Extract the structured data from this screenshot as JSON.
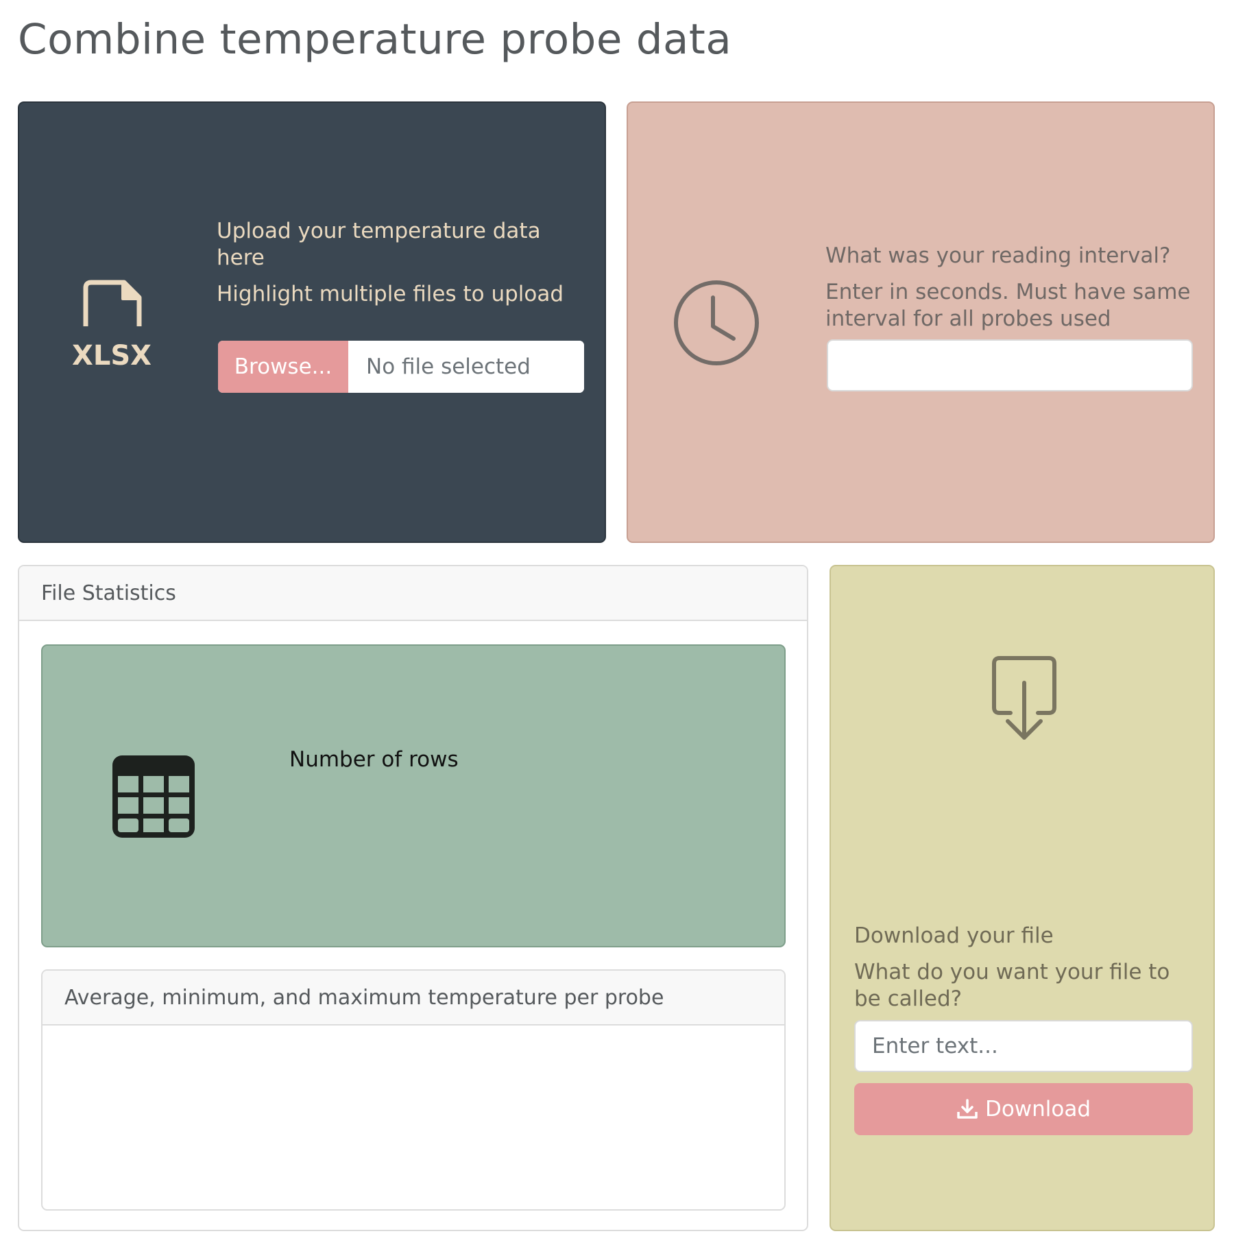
{
  "page": {
    "title": "Combine temperature probe data"
  },
  "upload": {
    "icon": "xlsx-file-icon",
    "icon_text": "XLSX",
    "heading": "Upload your temperature data here",
    "subheading": "Highlight multiple files to upload",
    "browse_label": "Browse...",
    "file_status": "No file selected",
    "background_color": "#3b4752",
    "text_color": "#ebdac0"
  },
  "interval": {
    "icon": "clock-icon",
    "heading": "What was your reading interval?",
    "subheading": "Enter in seconds. Must have same interval for all probes used",
    "value": "",
    "background_color": "#dfbcb0"
  },
  "stats": {
    "header": "File Statistics",
    "rows_box": {
      "icon": "table-icon",
      "label": "Number of rows",
      "value": "",
      "background_color": "#9ebba9"
    },
    "probe_card": {
      "header": "Average, minimum, and maximum temperature per probe"
    }
  },
  "download": {
    "icon": "download-icon",
    "heading": "Download your file",
    "subheading": "What do you want your file to be called?",
    "filename_placeholder": "Enter text...",
    "filename_value": "",
    "button_icon": "download-arrow-icon",
    "button_label": "Download",
    "background_color": "#dedaae",
    "button_color": "#e59a9b"
  }
}
